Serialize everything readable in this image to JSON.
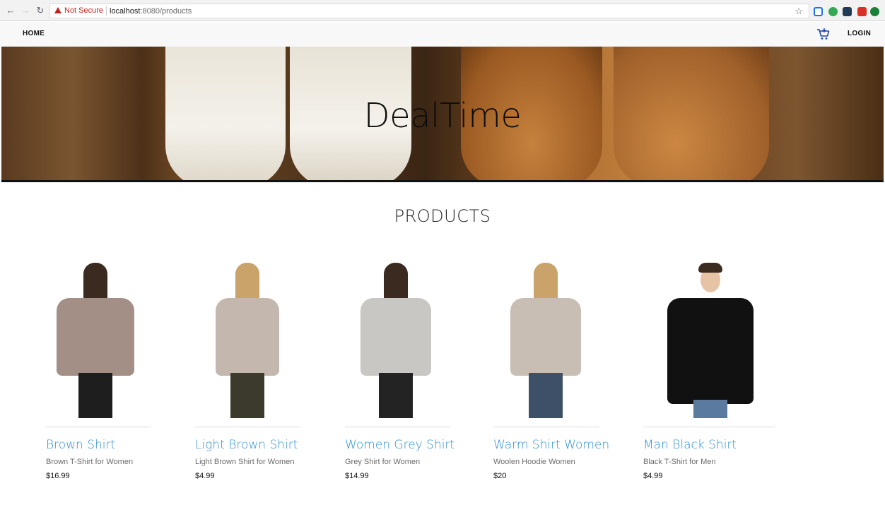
{
  "browser": {
    "security_label": "Not Secure",
    "url_host": "localhost",
    "url_path": ":8080/products",
    "extensions": [
      "#1a73e8",
      "#34a853",
      "#1f3b57",
      "#d93025",
      "#188038"
    ]
  },
  "nav": {
    "home_label": "HOME",
    "login_label": "LOGIN",
    "cart_icon": "cart-icon"
  },
  "hero": {
    "title": "DealTime"
  },
  "products_section": {
    "title": "PRODUCTS",
    "items": [
      {
        "name": "Brown Shirt",
        "description": "Brown T-Shirt for Women",
        "price": "$16.99",
        "garment_color": "#a38f86",
        "pants_color": "#1e1e1e"
      },
      {
        "name": "Light Brown Shirt",
        "description": "Light Brown Shirt for Women",
        "price": "$4.99",
        "garment_color": "#c4b8ae",
        "pants_color": "#3b3a2c"
      },
      {
        "name": "Women Grey Shirt",
        "description": "Grey Shirt for Women",
        "price": "$14.99",
        "garment_color": "#c9c7c3",
        "pants_color": "#232323"
      },
      {
        "name": "Warm Shirt Women",
        "description": "Woolen Hoodie Women",
        "price": "$20",
        "garment_color": "#c8beb3",
        "pants_color": "#3e5068"
      },
      {
        "name": "Man Black Shirt",
        "description": "Black T-Shirt for Men",
        "price": "$4.99",
        "garment_color": "#111111",
        "pants_color": "#5b7aa0"
      }
    ]
  },
  "colors": {
    "link": "#2b8fd6",
    "nav_bg": "#f8f8f8"
  }
}
